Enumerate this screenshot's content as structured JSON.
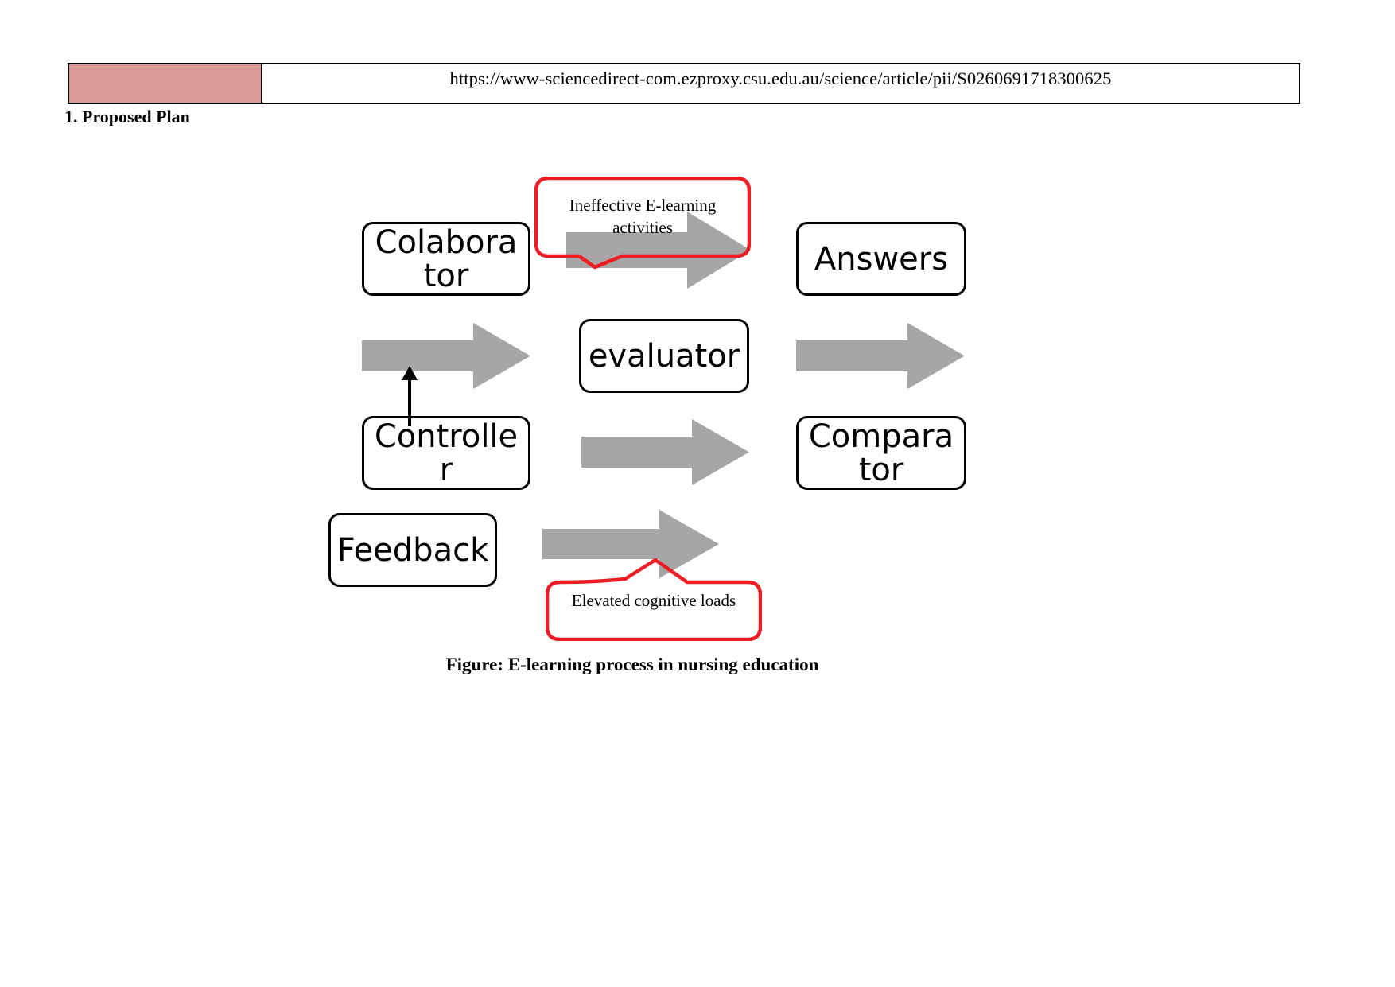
{
  "page": {
    "background_color": "#ffffff"
  },
  "header": {
    "color_cell_fill": "#d89a96",
    "url": "https://www-sciencedirect-com.ezproxy.csu.edu.au/science/article/pii/S0260691718300625"
  },
  "section": {
    "heading": "1. Proposed Plan"
  },
  "diagram": {
    "arrow_fill": "#a6a6a6",
    "callout_stroke": "#ee1c25",
    "box_stroke": "#000000",
    "boxes": [
      {
        "id": "colaborator",
        "label": "Colaborator"
      },
      {
        "id": "answers",
        "label": "Answers"
      },
      {
        "id": "evaluator",
        "label": "evaluator"
      },
      {
        "id": "controller",
        "label": "Controller"
      },
      {
        "id": "comparator",
        "label": "Comparator"
      },
      {
        "id": "feedback",
        "label": "Feedback"
      }
    ],
    "callouts": [
      {
        "id": "ineffective",
        "line1": "Ineffective E-learning",
        "line2": "activities"
      },
      {
        "id": "cognitive",
        "line1": "Elevated cognitive loads",
        "line2": ""
      }
    ],
    "arrows": [
      {
        "id": "arrow-top",
        "direction": "right"
      },
      {
        "id": "arrow-midleft",
        "direction": "right"
      },
      {
        "id": "arrow-midright",
        "direction": "right"
      },
      {
        "id": "arrow-row3",
        "direction": "right"
      },
      {
        "id": "arrow-bottom",
        "direction": "right"
      },
      {
        "id": "arrow-feedback-up",
        "direction": "up"
      }
    ]
  },
  "caption": {
    "text": "Figure: E-learning process in nursing education"
  }
}
